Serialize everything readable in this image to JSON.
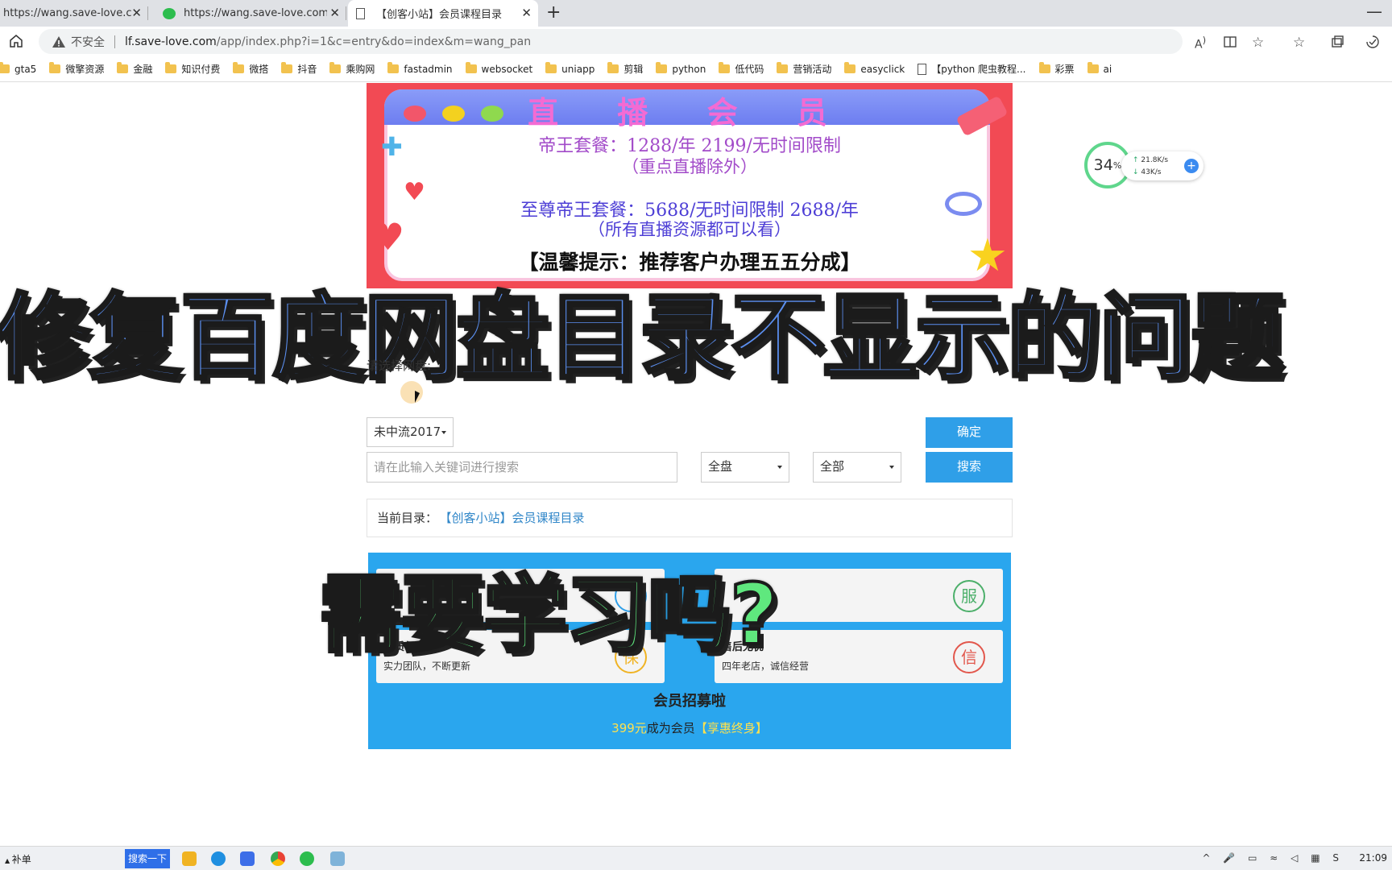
{
  "browser": {
    "tabs": [
      {
        "title": "https://wang.save-love.com/web",
        "active": false
      },
      {
        "title": "https://wang.save-love.com/web",
        "active": false
      },
      {
        "title": "【创客小站】会员课程目录",
        "active": true
      }
    ],
    "address": {
      "insecure_label": "不安全",
      "host": "lf.save-love.com",
      "path": "/app/index.php?i=1&c=entry&do=index&m=wang_pan"
    },
    "bookmarks": [
      "gta5",
      "微擎资源",
      "金融",
      "知识付费",
      "微搭",
      "抖音",
      "乘购网",
      "fastadmin",
      "websocket",
      "uniapp",
      "剪辑",
      "python",
      "低代码",
      "营销活动",
      "easyclick",
      "【python 爬虫教程...",
      "彩票",
      "ai"
    ]
  },
  "banner": {
    "title": "直 播 会 员",
    "line1": "帝王套餐：1288/年    2199/无时间限制",
    "line2": "（重点直播除外）",
    "line3": "至尊帝王套餐：5688/无时间限制    2688/年",
    "line4": "（所有直播资源都可以看）",
    "line5": "【温馨提示：推荐客户办理五五分成】"
  },
  "overlay": {
    "headline": "修复百度网盘目录不显示的问题",
    "question": "需要学习吗?"
  },
  "speed_widget": {
    "percent": "34",
    "percent_unit": "%",
    "upload": "21.8K/s",
    "download": "43K/s"
  },
  "form": {
    "choose_label": "请选择网盘:",
    "disk_select": "未中流2017",
    "confirm": "确定",
    "search_placeholder": "请在此输入关键词进行搜索",
    "scope_select": "全盘",
    "type_select": "全部",
    "search": "搜索"
  },
  "breadcrumb": {
    "label": "当前目录：",
    "link": "【创客小站】会员课程目录"
  },
  "member": {
    "cards": [
      {
        "title": "",
        "subtitle": "",
        "badge": "服",
        "color": "#4caf6a"
      },
      {
        "title": "品质保障",
        "subtitle": "实力团队，不断更新",
        "badge": "保",
        "color": "#f0b323"
      },
      {
        "title": "售后无忧",
        "subtitle": "四年老店，诚信经营",
        "badge": "信",
        "color": "#e2574c"
      }
    ],
    "title": "会员招募啦",
    "price": "399元",
    "price_suffix": "成为会员",
    "promo": "【享惠终身】"
  },
  "taskbar": {
    "left_text": "补单",
    "search": "搜索一下",
    "clock": "21:09"
  }
}
